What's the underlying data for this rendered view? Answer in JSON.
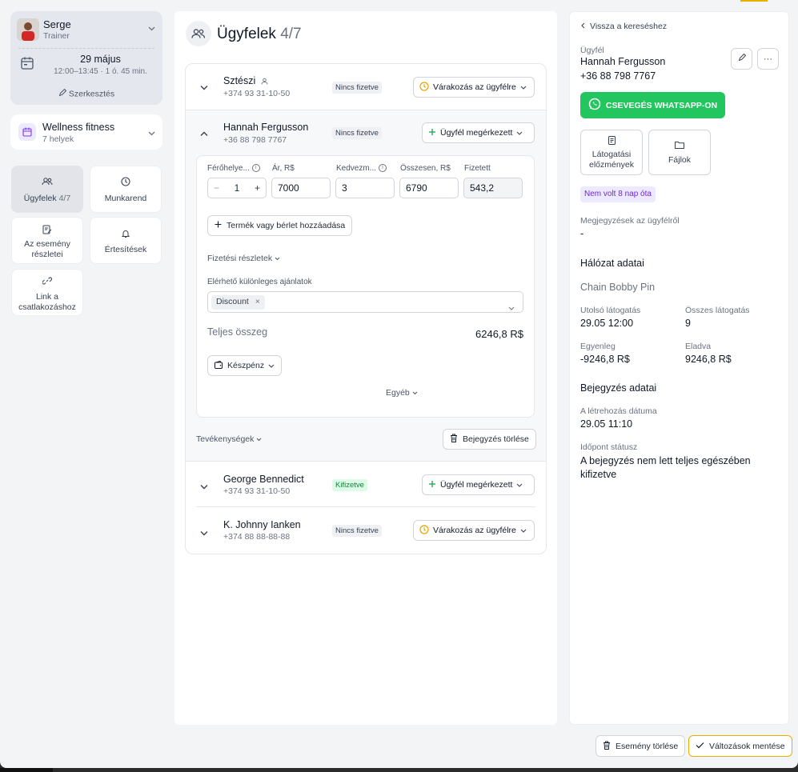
{
  "trainer": {
    "name": "Serge",
    "role": "Trainer"
  },
  "event": {
    "date": "29 május",
    "time": "12:00–13:45 · 1 ó. 45 min.",
    "edit_label": "Szerkesztés"
  },
  "venue": {
    "name": "Wellness fitness",
    "places": "7 helyek"
  },
  "nav": {
    "clients_label": "Ügyfelek",
    "clients_count": "4/7",
    "schedule": "Munkarend",
    "event_details_1": "Az esemény",
    "event_details_2": "részletei",
    "notifications": "Értesítések",
    "join_link_1": "Link a",
    "join_link_2": "csatlakozáshoz"
  },
  "main": {
    "title": "Ügyfelek",
    "count": "4/7"
  },
  "clients": [
    {
      "name": "Sztészi",
      "phone": "+374 93 31-10-50",
      "payment": "Nincs fizetve",
      "status": "Várakozás az ügyfélre"
    },
    {
      "name": "Hannah Fergusson",
      "phone": "+36 88 798 7767",
      "payment": "Nincs fizetve",
      "status": "Ügyfél megérkezett"
    },
    {
      "name": "George Bennedict",
      "phone": "+374 93 31-10-50",
      "payment": "Kifizetve",
      "status": "Ügyfél megérkezett"
    },
    {
      "name": "K. Johnny Ianken",
      "phone": "+374 88 88-88-88",
      "payment": "Nincs fizetve",
      "status": "Várakozás az ügyfélre"
    }
  ],
  "detail": {
    "labels": {
      "seats": "Férőhelye...",
      "price": "Ár, R$",
      "discount": "Kedvezm...",
      "total": "Összesen, R$",
      "paid": "Fizetett"
    },
    "values": {
      "seats": "1",
      "price": "7000",
      "discount": "3",
      "total": "6790",
      "paid": "543,2"
    },
    "stepper_minus": "−",
    "stepper_plus": "+",
    "add_product": "Termék vagy bérlet hozzáadása",
    "payment_details": "Fizetési részletek",
    "offers_label": "Elérhető különleges ajánlatok",
    "offer_chip": "Discount",
    "chip_remove": "×",
    "grand_total_label": "Teljes összeg",
    "grand_total_value": "6246,8 R$",
    "pay_method": "Készpénz",
    "other": "Egyéb",
    "activities": "Tevékenységek",
    "delete_entry": "Bejegyzés törlése"
  },
  "right": {
    "back": "Vissza a kereséshez",
    "client_label": "Ügyfél",
    "client_name": "Hannah Fergusson",
    "client_phone": "+36 88 798 7767",
    "more": "···",
    "whatsapp": "CSEVEGÉS WHATSAPP-ON",
    "visits_history_1": "Látogatási",
    "visits_history_2": "előzmények",
    "files": "Fájlok",
    "absence_badge": "Nem volt 8 nap óta",
    "notes_label": "Megjegyzések az ügyfélről",
    "notes_value": "-",
    "network_heading": "Hálózat adatai",
    "network_name": "Chain Bobby Pin",
    "last_visit_label": "Utolsó látogatás",
    "last_visit_value": "29.05 12:00",
    "total_visits_label": "Összes látogatás",
    "total_visits_value": "9",
    "balance_label": "Egyenleg",
    "balance_value": "-9246,8 R$",
    "sold_label": "Eladva",
    "sold_value": "9246,8 R$",
    "entry_heading": "Bejegyzés adatai",
    "created_label": "A létrehozás dátuma",
    "created_value": "29.05 11:10",
    "slot_status_label": "Időpont státusz",
    "slot_status_value": "A bejegyzés nem lett teljes egészében kifizetve"
  },
  "footer": {
    "delete_event": "Esemény törlése",
    "save_changes": "Változások mentése"
  },
  "colors": {
    "whatsapp": "#22c55e",
    "paid_badge": "#dcfce7",
    "purple_badge": "#ede9fe",
    "save_border": "#e6b000",
    "clock_icon": "#e6a400",
    "check_green": "#16a34a"
  }
}
